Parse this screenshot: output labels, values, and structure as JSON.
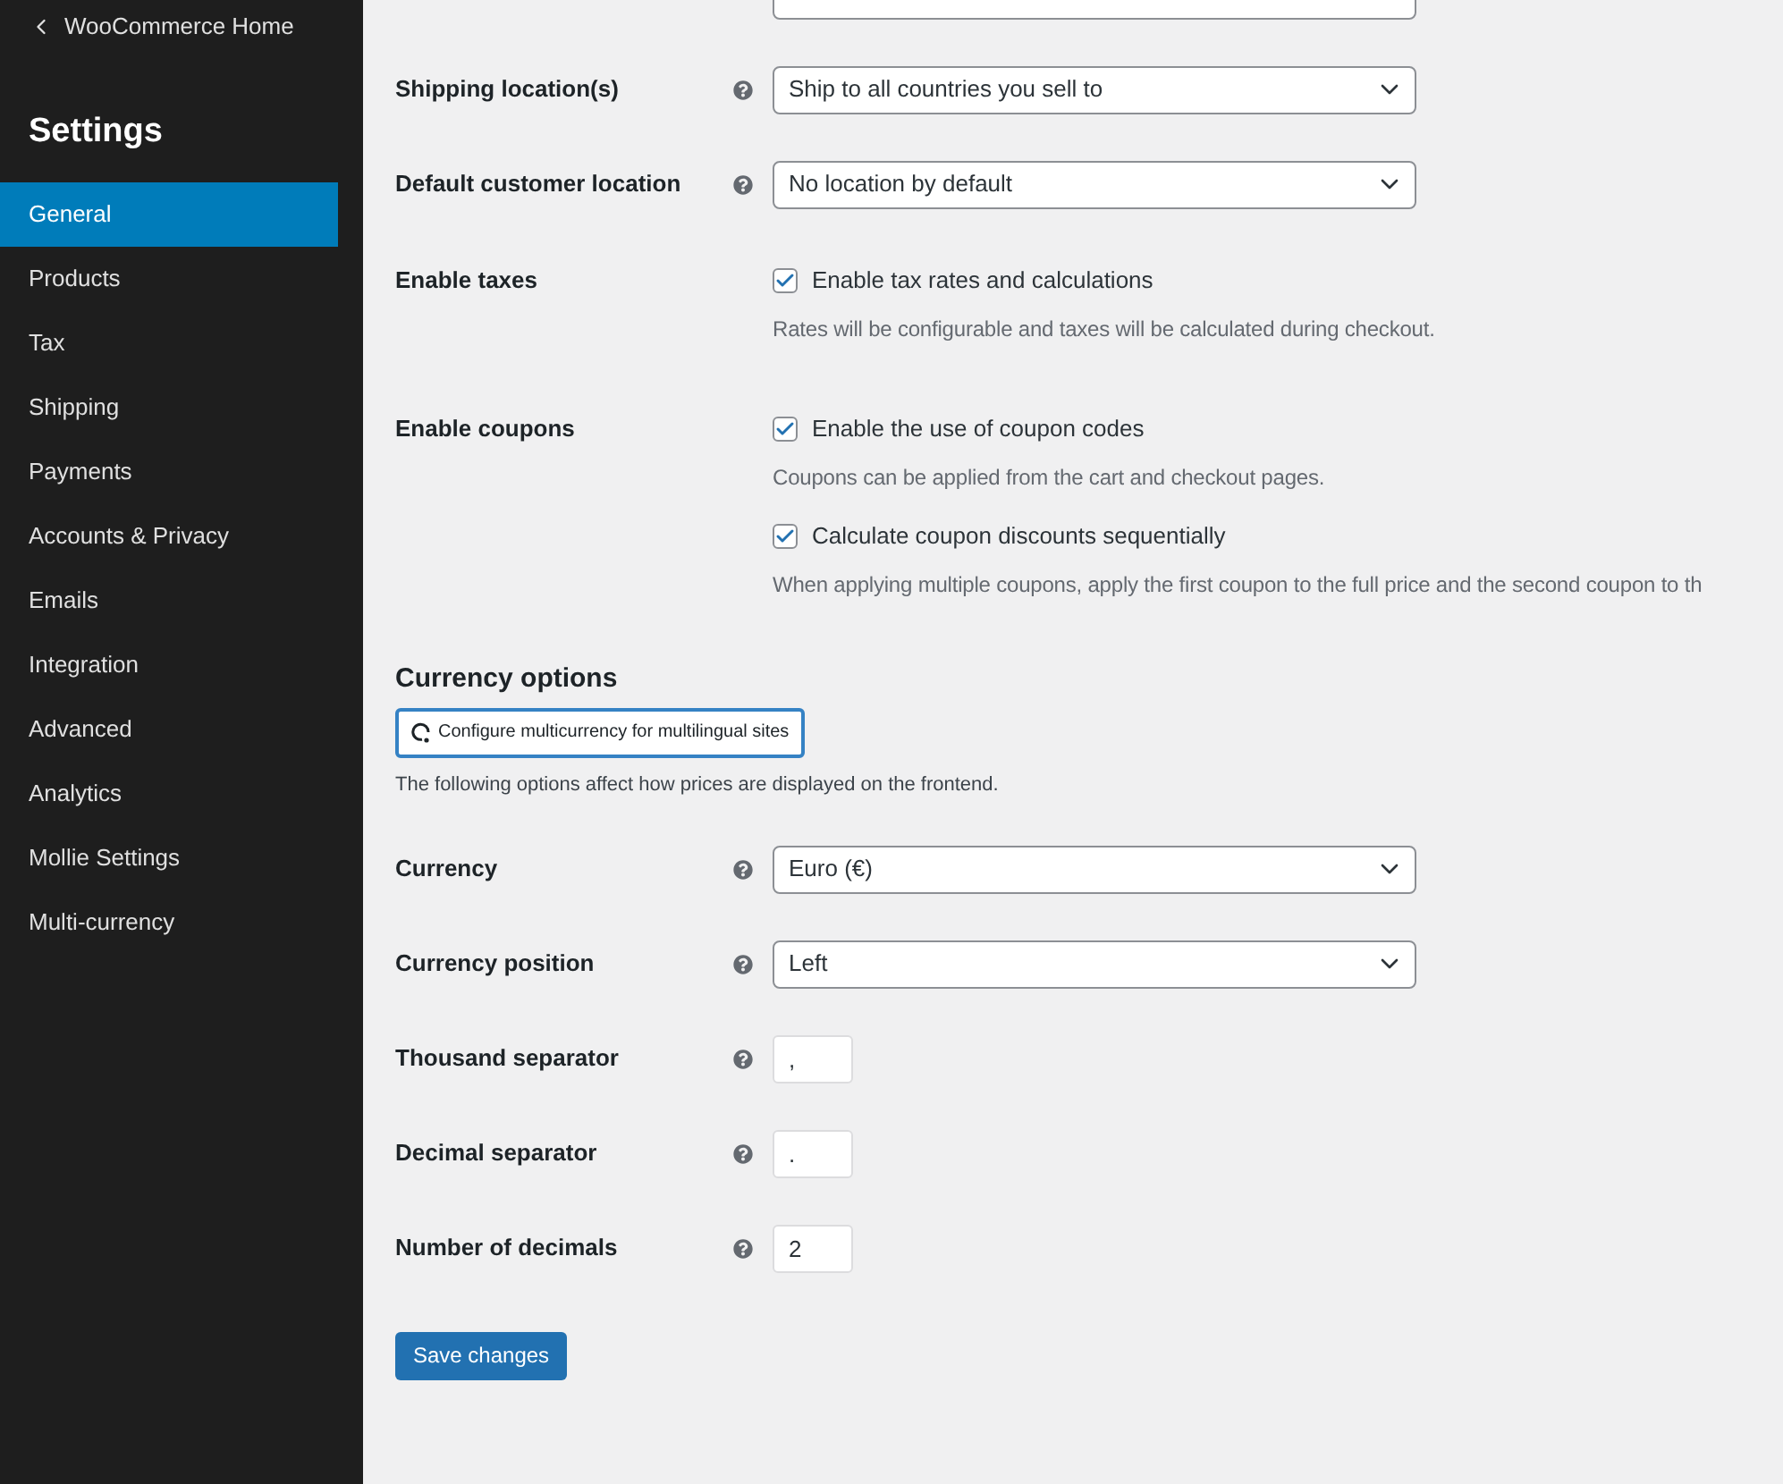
{
  "sidebar": {
    "back_link": "WooCommerce Home",
    "heading": "Settings",
    "items": [
      {
        "label": "General",
        "selected": true
      },
      {
        "label": "Products",
        "selected": false
      },
      {
        "label": "Tax",
        "selected": false
      },
      {
        "label": "Shipping",
        "selected": false
      },
      {
        "label": "Payments",
        "selected": false
      },
      {
        "label": "Accounts & Privacy",
        "selected": false
      },
      {
        "label": "Emails",
        "selected": false
      },
      {
        "label": "Integration",
        "selected": false
      },
      {
        "label": "Advanced",
        "selected": false
      },
      {
        "label": "Analytics",
        "selected": false
      },
      {
        "label": "Mollie Settings",
        "selected": false
      },
      {
        "label": "Multi-currency",
        "selected": false
      }
    ]
  },
  "settings": [
    {
      "kind": "select"
    },
    {
      "kind": "select",
      "label": "Shipping location(s)",
      "value": "Ship to all countries you sell to"
    },
    {
      "kind": "select",
      "label": "Default customer location",
      "value": "No location by default"
    },
    {
      "kind": "checkbox",
      "label": "Enable taxes",
      "options": [
        {
          "text": "Enable tax rates and calculations",
          "checked": true,
          "description": "Rates will be configurable and taxes will be calculated during checkout."
        }
      ]
    },
    {
      "kind": "checkbox",
      "label": "Enable coupons",
      "options": [
        {
          "text": "Enable the use of coupon codes",
          "checked": true,
          "description": "Coupons can be applied from the cart and checkout pages."
        },
        {
          "text": "Calculate coupon discounts sequentially",
          "checked": true,
          "description": "When applying multiple coupons, apply the first coupon to the full price and the second coupon to th"
        }
      ]
    }
  ],
  "currency": {
    "heading": "Currency options",
    "button": "Configure multicurrency for multilingual sites",
    "description": "The following options affect how prices are displayed on the frontend.",
    "fields": [
      {
        "kind": "select",
        "label": "Currency",
        "value": "Euro (€)"
      },
      {
        "kind": "select",
        "label": "Currency position",
        "value": "Left"
      },
      {
        "kind": "text",
        "label": "Thousand separator",
        "value": ","
      },
      {
        "kind": "text",
        "label": "Decimal separator",
        "value": "."
      },
      {
        "kind": "text",
        "label": "Number of decimals",
        "value": "2"
      }
    ]
  },
  "save_button": "Save changes"
}
